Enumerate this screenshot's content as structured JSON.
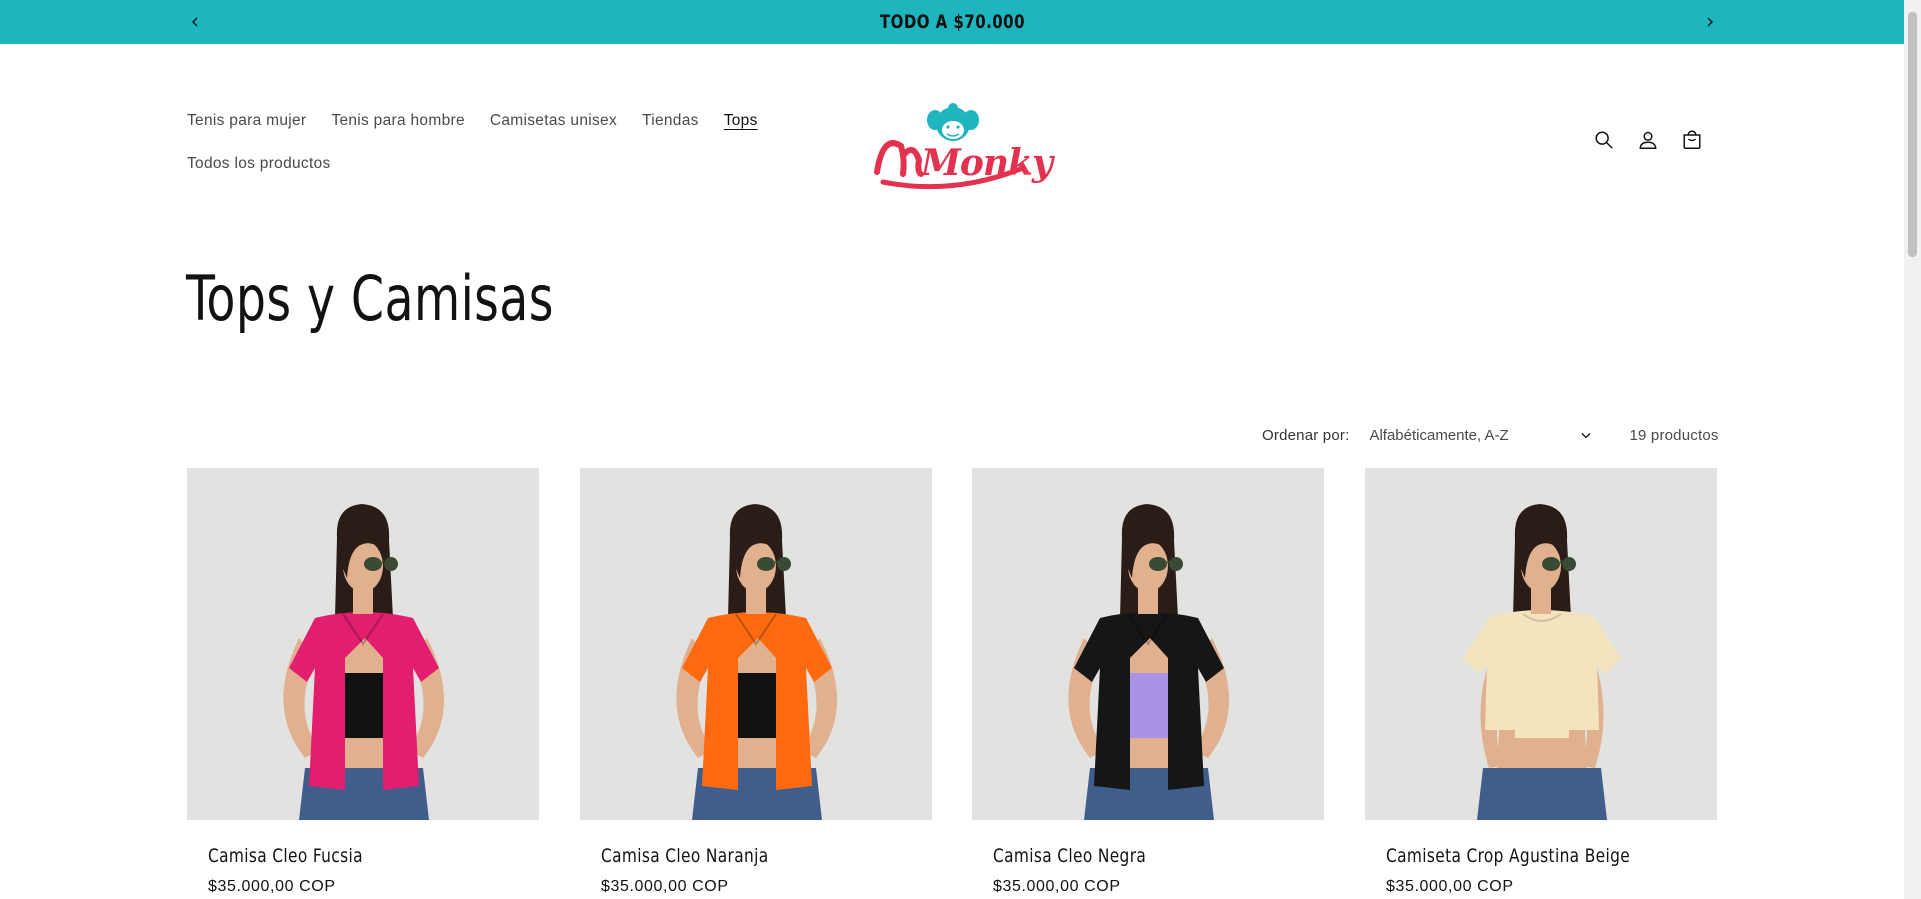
{
  "announcement": {
    "text": "TODO A $70.000",
    "prev_icon": "chevron-left-icon",
    "next_icon": "chevron-right-icon"
  },
  "header": {
    "nav": [
      {
        "label": "Tenis para mujer",
        "active": false
      },
      {
        "label": "Tenis para hombre",
        "active": false
      },
      {
        "label": "Camisetas unisex",
        "active": false
      },
      {
        "label": "Tiendas",
        "active": false
      },
      {
        "label": "Tops",
        "active": true
      },
      {
        "label": "Todos los productos",
        "active": false
      }
    ],
    "logo_text": "Monky",
    "icons": [
      "search-icon",
      "account-icon",
      "cart-icon"
    ]
  },
  "collection": {
    "title": "Tops y Camisas",
    "sort_label": "Ordenar por:",
    "sort_value": "Alfabéticamente, A-Z",
    "count": "19 productos"
  },
  "products": [
    {
      "title": "Camisa Cleo Fucsia",
      "price": "$35.000,00 COP",
      "garment_color": "#e11f6e",
      "inner_color": "#111111"
    },
    {
      "title": "Camisa Cleo Naranja",
      "price": "$35.000,00 COP",
      "garment_color": "#ff6a10",
      "inner_color": "#111111"
    },
    {
      "title": "Camisa Cleo Negra",
      "price": "$35.000,00 COP",
      "garment_color": "#161616",
      "inner_color": "#a993e6"
    },
    {
      "title": "Camiseta Crop Agustina Beige",
      "price": "$35.000,00 COP",
      "garment_color": "#f3e4bd",
      "inner_color": "#f3e4bd"
    }
  ],
  "colors": {
    "announcement_bg": "#1fb5bf",
    "logo_red": "#e3324e",
    "logo_teal": "#1fb5bf",
    "image_bg": "#e2e3e1"
  }
}
